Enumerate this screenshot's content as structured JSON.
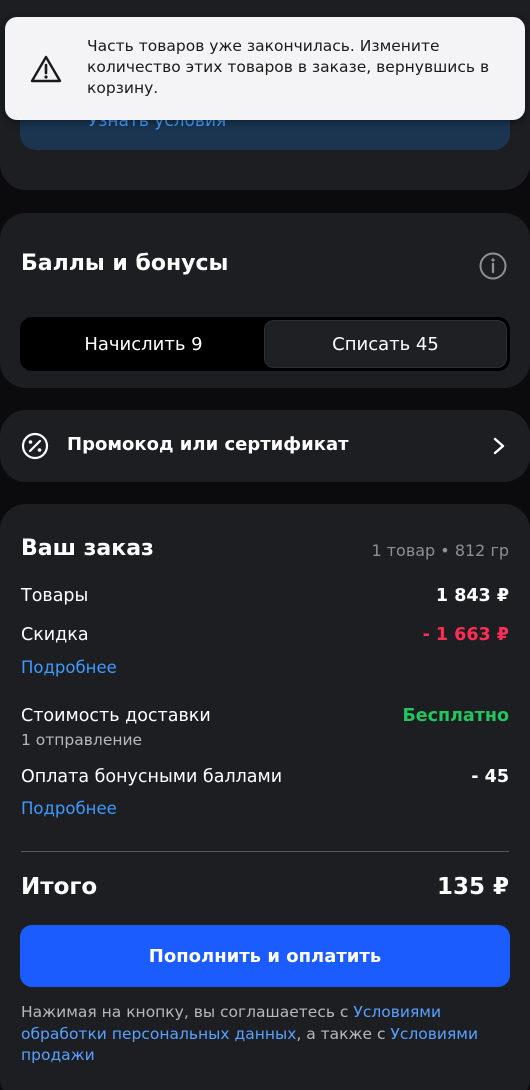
{
  "toast": {
    "message": "Часть товаров уже закончилась. Измените количество этих товаров в заказе, вернувшись в корзину."
  },
  "promo_banner": {
    "link": "Узнать условия"
  },
  "bonuses": {
    "title": "Баллы и бонусы",
    "options": [
      "Начислить 9",
      "Списать 45"
    ],
    "selected": "Списать 45"
  },
  "promocode": {
    "label": "Промокод или сертификат"
  },
  "order": {
    "title": "Ваш заказ",
    "meta": "1 товар • 812 гр",
    "goods_label": "Товары",
    "goods_value": "1 843 ₽",
    "discount_label": "Скидка",
    "discount_value": "- 1 663 ₽",
    "discount_details": "Подробнее",
    "delivery_label": "Стоимость доставки",
    "delivery_sub": "1 отправление",
    "delivery_value": "Бесплатно",
    "bonus_pay_label": "Оплата бонусными баллами",
    "bonus_pay_value": "- 45",
    "bonus_details": "Подробнее",
    "total_label": "Итого",
    "total_value": "135 ₽",
    "pay_button": "Пополнить и оплатить"
  },
  "legal": {
    "part1": "Нажимая на кнопку, вы соглашаетесь с ",
    "link1": "Условиями обработки персональных данных",
    "part2": ", а также с ",
    "link2": "Условиями продажи"
  },
  "colors": {
    "accent": "#1a5cff",
    "link": "#3e9bff",
    "discount": "#ff2d55",
    "free": "#22c55e",
    "card": "#1c1e22"
  },
  "icons": [
    "warning-icon",
    "info-icon",
    "discount-icon",
    "chevron-right-icon"
  ]
}
